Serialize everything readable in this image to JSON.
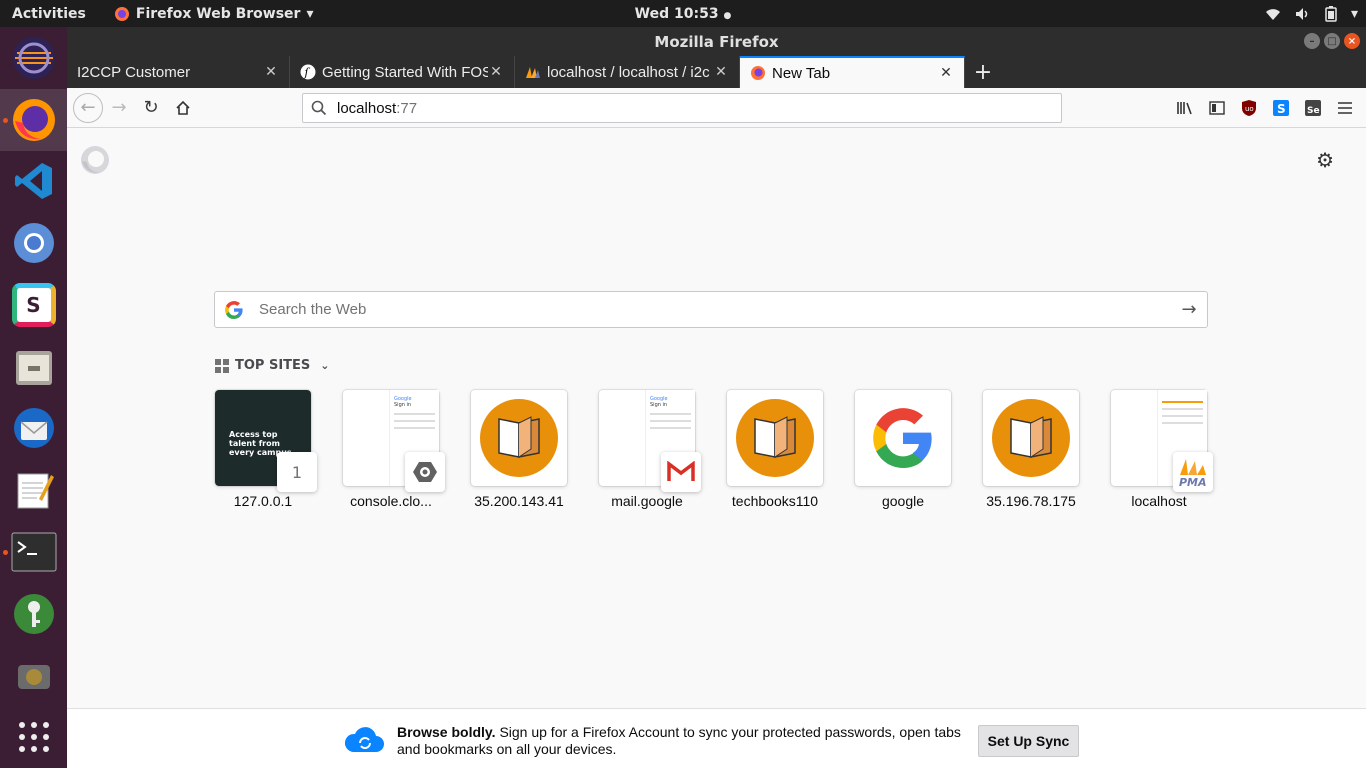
{
  "topbar": {
    "activities": "Activities",
    "app_name": "Firefox Web Browser",
    "clock": "Wed 10:53"
  },
  "window": {
    "title": "Mozilla Firefox"
  },
  "tabs": [
    {
      "title": "I2CCP Customer",
      "favicon": "none"
    },
    {
      "title": "Getting Started With FOS",
      "favicon": "symfony-icon"
    },
    {
      "title": "localhost / localhost / i2c",
      "favicon": "phpmyadmin-icon"
    },
    {
      "title": "New Tab",
      "favicon": "firefox-icon",
      "active": true
    }
  ],
  "url": {
    "host": "localhost",
    "rest": ":77"
  },
  "search": {
    "placeholder": "Search the Web"
  },
  "top_sites": {
    "header": "TOP SITES",
    "items": [
      {
        "label": "127.0.0.1",
        "badge": "1",
        "thumb_text": "Access top talent from every campus"
      },
      {
        "label": "console.clo...",
        "doc_title": "Google",
        "doc_heading": "Sign in"
      },
      {
        "label": "35.200.143.41"
      },
      {
        "label": "mail.google",
        "doc_title": "Google",
        "doc_heading": "Sign in"
      },
      {
        "label": "techbooks110"
      },
      {
        "label": "google"
      },
      {
        "label": "35.196.78.175"
      },
      {
        "label": "localhost",
        "badge": "PMA"
      }
    ]
  },
  "sync": {
    "bold": "Browse boldly.",
    "text": "Sign up for a Firefox Account to sync your protected passwords, open tabs and bookmarks on all your devices.",
    "button": "Set Up Sync"
  },
  "colors": {
    "accent": "#0a84ff",
    "ubuntu_orange": "#e95420",
    "dock_bg": "#3c1e34",
    "book_orange": "#e9900a"
  }
}
